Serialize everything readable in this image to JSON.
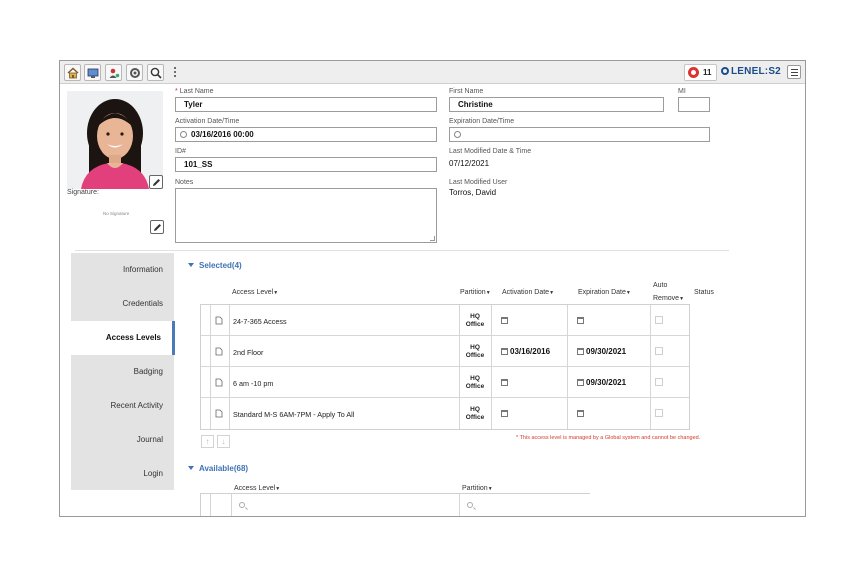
{
  "toolbar": {
    "icons": [
      "home-icon",
      "monitor-icon",
      "person-pin-icon",
      "gear-icon",
      "search-icon",
      "more-vert-icon"
    ],
    "badge_count": "11",
    "logo_prefix": "LENEL",
    "logo_sep": ":",
    "logo_suffix": "S2",
    "menu_icon": "list-icon"
  },
  "profile": {
    "signature_label": "Signature:",
    "no_signature": "No Signature"
  },
  "fields": {
    "last_name_label": "Last Name",
    "last_name_required": "*",
    "last_name": "Tyler",
    "first_name_label": "First Name",
    "first_name": "Christine",
    "mi_label": "MI",
    "mi": "",
    "activation_label": "Activation Date/Time",
    "activation": "03/16/2016 00:00",
    "expiration_label": "Expiration Date/Time",
    "expiration": "",
    "id_label": "ID#",
    "id": "101_SS",
    "last_modified_label": "Last Modified Date & Time",
    "last_modified": "07/12/2021",
    "notes_label": "Notes",
    "notes": "",
    "last_modified_user_label": "Last Modified User",
    "last_modified_user": "Torros, David"
  },
  "tabs": [
    {
      "label": "Information",
      "active": false
    },
    {
      "label": "Credentials",
      "active": false
    },
    {
      "label": "Access Levels",
      "active": true
    },
    {
      "label": "Badging",
      "active": false
    },
    {
      "label": "Recent Activity",
      "active": false
    },
    {
      "label": "Journal",
      "active": false
    },
    {
      "label": "Login",
      "active": false
    }
  ],
  "selected": {
    "title": "Selected(4)",
    "columns": {
      "access_level": "Access Level",
      "partition": "Partition",
      "activation_date": "Activation Date",
      "expiration_date": "Expiration Date",
      "auto_line1": "Auto",
      "auto_line2": "Remove",
      "status": "Status"
    },
    "rows": [
      {
        "name": "24-7-365 Access",
        "partition_line1": "HQ",
        "partition_line2": "Office",
        "activation": "",
        "expiration": ""
      },
      {
        "name": "2nd Floor",
        "partition_line1": "HQ",
        "partition_line2": "Office",
        "activation": "03/16/2016",
        "expiration": "09/30/2021"
      },
      {
        "name": "6 am -10 pm",
        "partition_line1": "HQ",
        "partition_line2": "Office",
        "activation": "",
        "expiration": "09/30/2021"
      },
      {
        "name": "Standard M-S 6AM-7PM - Apply To All",
        "partition_line1": "HQ",
        "partition_line2": "Office",
        "activation": "",
        "expiration": ""
      }
    ],
    "note": "* This access level is managed by a Global system and cannot be changed."
  },
  "available": {
    "title": "Available(68)",
    "columns": {
      "access_level": "Access Level",
      "partition": "Partition"
    }
  },
  "colors": {
    "accent": "#3f73b4",
    "warning_text": "#d43a2a",
    "tab_bg": "#e3e3e3"
  }
}
